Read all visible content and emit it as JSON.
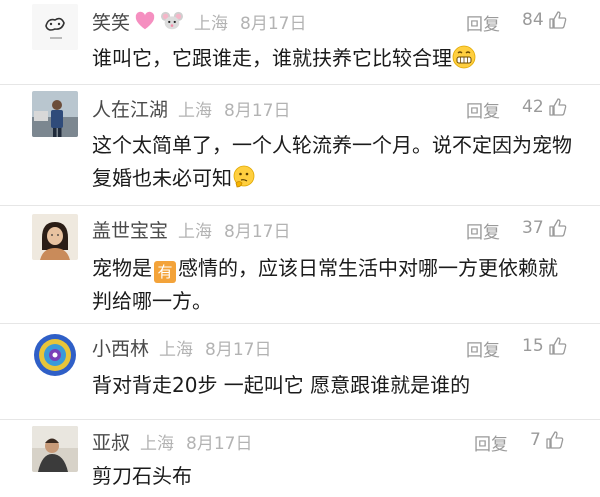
{
  "comments": [
    {
      "name": "笑笑",
      "location": "上海",
      "date": "8月17日",
      "reply": "回复",
      "likes": "84",
      "text": "谁叫它，它跟谁走，谁就扶养它比较合理",
      "name_emojis": [
        "pink-heart-icon",
        "mouse-face-icon"
      ],
      "trailing_emoji": "grinning-face-icon"
    },
    {
      "name": "人在江湖",
      "location": "上海",
      "date": "8月17日",
      "reply": "回复",
      "likes": "42",
      "text": "这个太简单了，一个人轮流养一个月。说不定因为宠物复婚也未必可知",
      "trailing_emoji": "thinking-face-icon"
    },
    {
      "name": "盖世宝宝",
      "location": "上海",
      "date": "8月17日",
      "reply": "回复",
      "likes": "37",
      "text_before": "宠物是",
      "tag": "有",
      "text_after": "感情的，应该日常生活中对哪一方更依赖就判给哪一方。"
    },
    {
      "name": "小西林",
      "location": "上海",
      "date": "8月17日",
      "reply": "回复",
      "likes": "15",
      "text": "背对背走20步 一起叫它 愿意跟谁就是谁的"
    },
    {
      "name": "亚叔",
      "location": "上海",
      "date": "8月17日",
      "reply": "回复",
      "likes": "7",
      "text": "剪刀石头布"
    }
  ],
  "colors": {
    "name": "#4a4a4a",
    "meta": "#b3b3b3",
    "action": "#9a9a9a",
    "tag": "#f3a33a",
    "divider": "#e6e6e6"
  }
}
